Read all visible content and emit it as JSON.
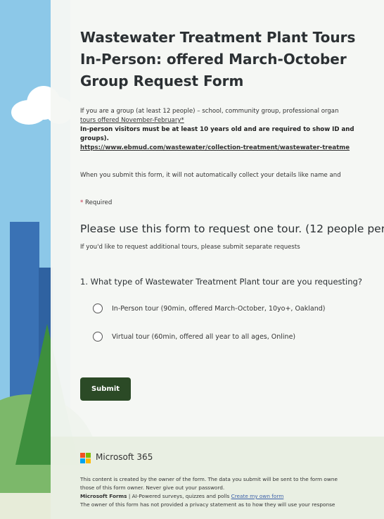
{
  "form": {
    "title_lines": [
      "Wastewater Treatment Plant Tours",
      "In-Person: offered March-October",
      "Group Request Form"
    ],
    "intro_line1": "If you are a group (at least 12 people) – school, community group, professional organ",
    "intro_line2_link": "tours offered November-February*",
    "intro_bold_line1": "In-person visitors must be at least 10 years old and are required to show ID and",
    "intro_bold_line2": "groups).",
    "intro_url": "https://www.ebmud.com/wastewater/collection-treatment/wastewater-treatme",
    "notice": "When you submit this form, it will not automatically collect your details like name and",
    "required_star": "*",
    "required_label": " Required",
    "section_title": "Please use this form to request one tour. (12 people per g",
    "section_subtitle": "If you'd like to request additional tours, please submit separate requests",
    "question": {
      "number": "1.",
      "text": "What type of Wastewater Treatment Plant tour are you requesting?",
      "options": [
        "In-Person tour (90min, offered March-October, 10yo+, Oakland)",
        "Virtual tour (60min, offered all year to all ages, Online)"
      ]
    },
    "submit_label": "Submit"
  },
  "footer": {
    "brand": "Microsoft 365",
    "line1": "This content is created by the owner of the form. The data you submit will be sent to the form owne",
    "line2": "those of this form owner. Never give out your password.",
    "forms_bold": "Microsoft Forms",
    "forms_tagline": " | AI-Powered surveys, quizzes and polls ",
    "create_link": "Create my own form",
    "line4": "The owner of this form has not provided a privacy statement as to how they will use your response"
  },
  "colors": {
    "submit_bg": "#2b4a26",
    "required": "#c4314b",
    "ms_red": "#f25022",
    "ms_green": "#7fba00",
    "ms_blue": "#00a4ef",
    "ms_yellow": "#ffb900"
  }
}
